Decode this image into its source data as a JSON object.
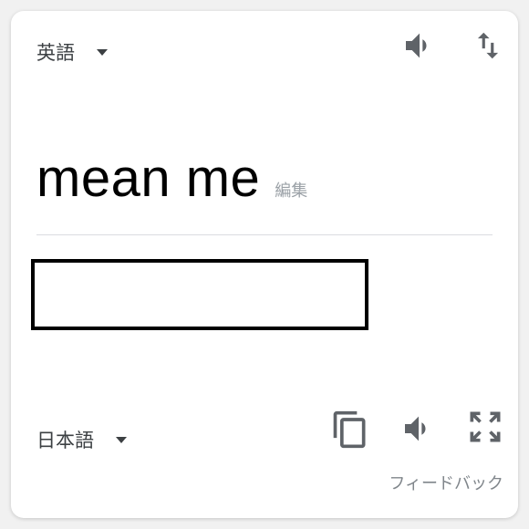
{
  "source": {
    "language": "英語",
    "text": "mean me",
    "edit_label": "編集"
  },
  "target": {
    "language": "日本語"
  },
  "icons": {
    "source_speak": "speaker-icon",
    "swap": "swap-languages-icon",
    "copy": "copy-icon",
    "target_speak": "speaker-icon",
    "expand": "fullscreen-icon"
  },
  "feedback_label": "フィードバック",
  "colors": {
    "icon": "#5f6368",
    "text": "#000000",
    "secondary_text": "#9aa0a6"
  }
}
